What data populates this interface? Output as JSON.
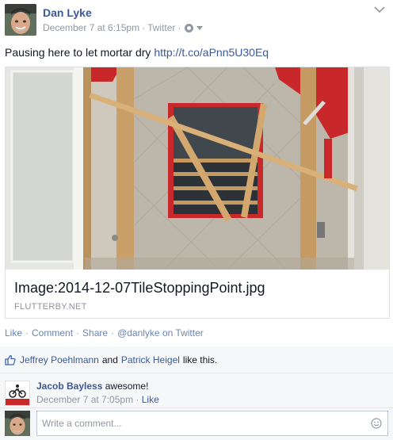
{
  "post": {
    "author": "Dan Lyke",
    "date": "December 7 at 6:15pm",
    "source": "Twitter",
    "text": "Pausing here to let mortar dry",
    "link": "http://t.co/aPnn5U30Eq"
  },
  "card": {
    "title": "Image:2014-12-07TileStoppingPoint.jpg",
    "domain": "FLUTTERBY.NET"
  },
  "actions": {
    "like": "Like",
    "comment": "Comment",
    "share": "Share",
    "twitter": "@danlyke on Twitter"
  },
  "likes": {
    "person1": "Jeffrey Poehlmann",
    "conj": "and",
    "person2": "Patrick Heigel",
    "suffix": "like this."
  },
  "comment": {
    "author": "Jacob Bayless",
    "text": "awesome!",
    "date": "December 7 at 7:05pm",
    "like": "Like"
  },
  "composer": {
    "placeholder": "Write a comment..."
  },
  "colors": {
    "link": "#3b5998",
    "muted": "#9197a3",
    "wall_red": "#c8282a"
  }
}
